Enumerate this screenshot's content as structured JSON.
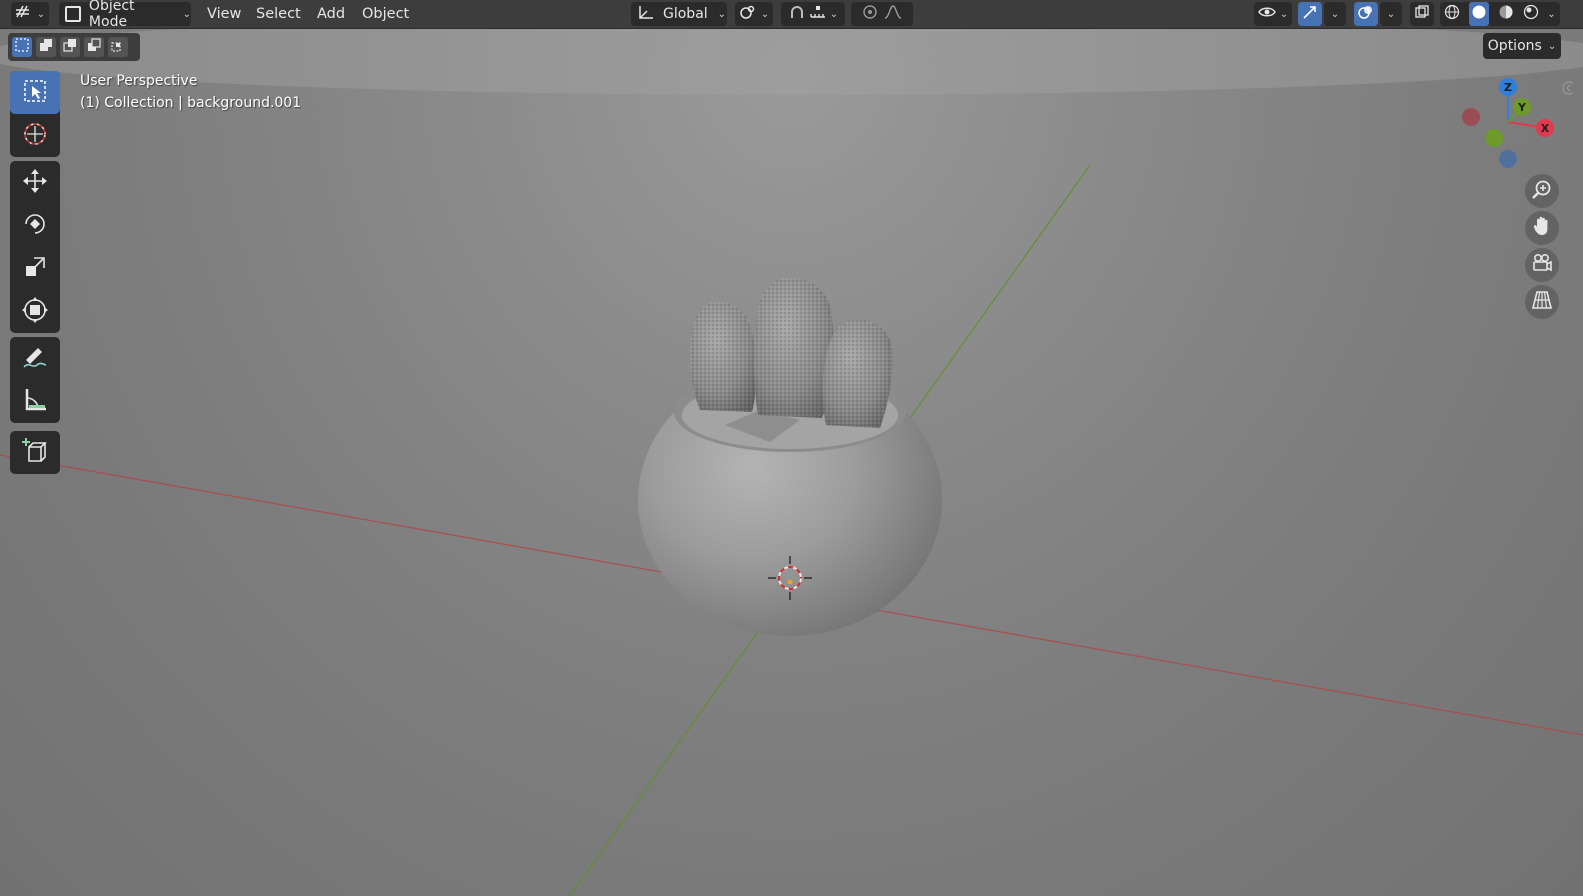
{
  "header": {
    "editor_type_icon": "grid-transform-icon",
    "mode_label": "Object Mode",
    "menus": [
      "View",
      "Select",
      "Add",
      "Object"
    ],
    "orientation_label": "Global"
  },
  "tool_header": {
    "options_label": "Options"
  },
  "viewport_info": {
    "perspective": "User Perspective",
    "collection": "(1) Collection | background.001"
  },
  "gizmo": {
    "z_label": "Z",
    "y_label": "Y",
    "x_label": "X",
    "colors": {
      "x": "#e13a4e",
      "y": "#6d9a29",
      "z": "#2f7fdd"
    }
  },
  "toolbar": {
    "tools": [
      "select-box-icon",
      "cursor-icon",
      "move-icon",
      "rotate-icon",
      "scale-icon",
      "transform-icon",
      "annotate-icon",
      "measure-icon",
      "add-cube-icon"
    ]
  },
  "colors": {
    "accent": "#4772b3",
    "header_bg": "#3d3d3d",
    "button_bg": "#2b2b2b"
  }
}
